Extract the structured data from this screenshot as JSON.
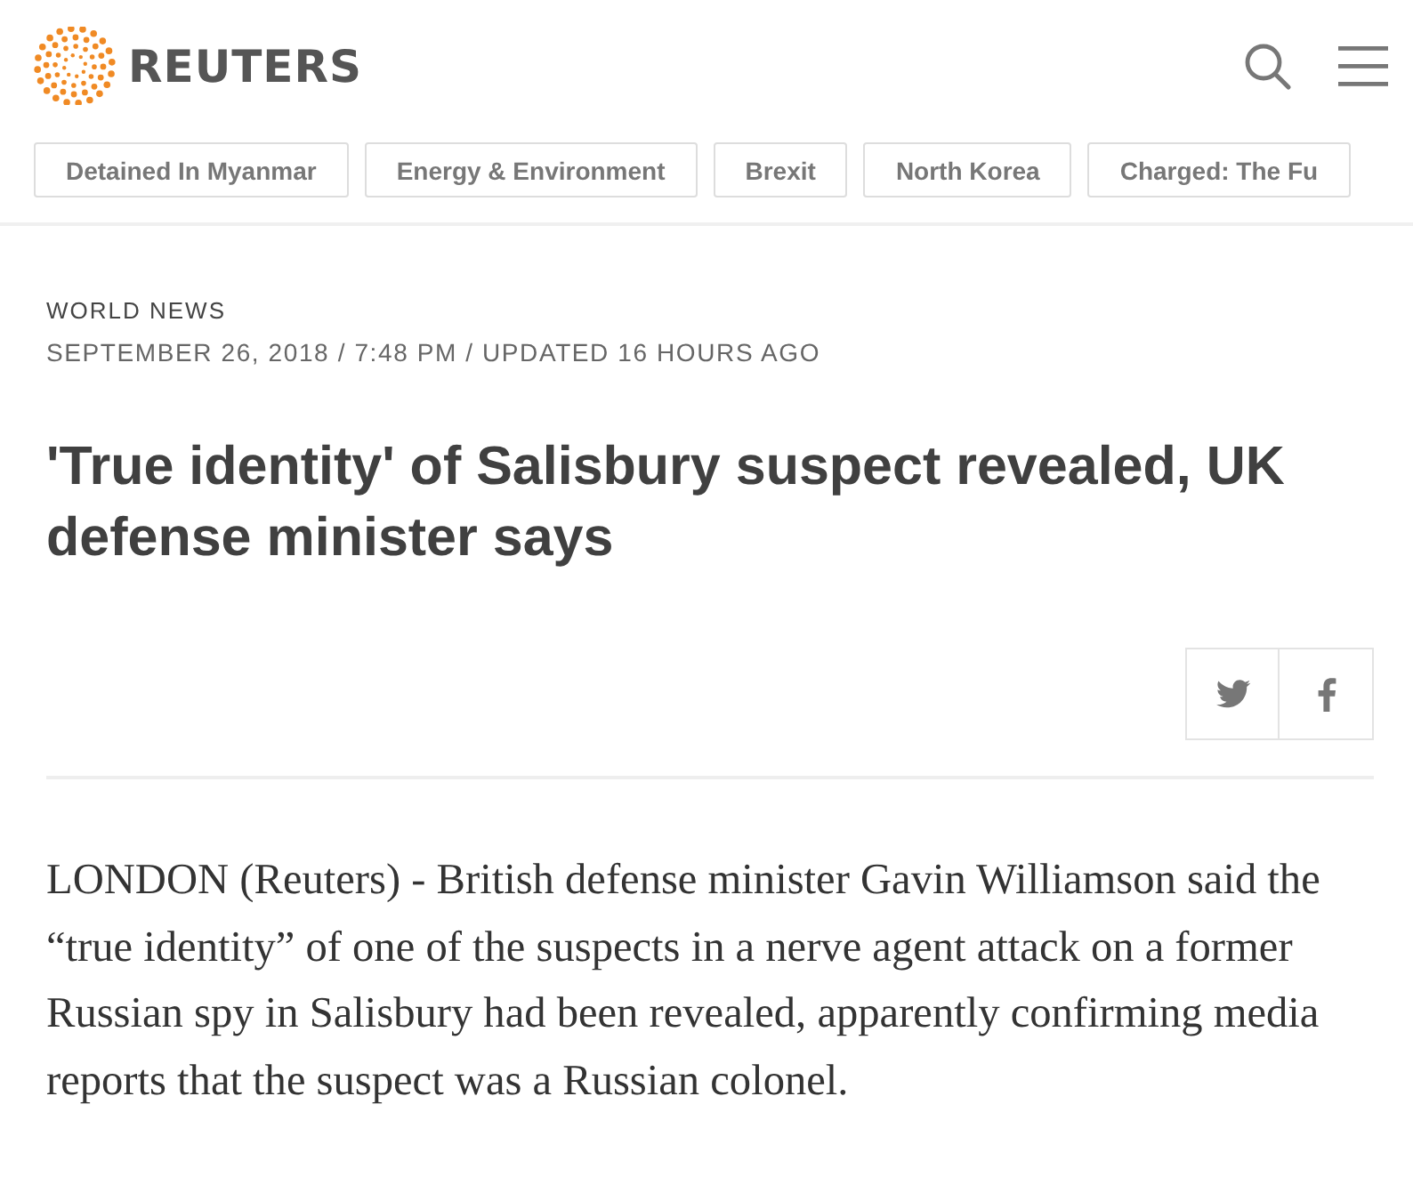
{
  "header": {
    "brand": "REUTERS"
  },
  "topics": [
    "Detained In Myanmar",
    "Energy & Environment",
    "Brexit",
    "North Korea",
    "Charged: The Fu"
  ],
  "article": {
    "section": "WORLD NEWS",
    "dateline": "SEPTEMBER 26, 2018 / 7:48 PM / UPDATED 16 HOURS AGO",
    "headline": "'True identity' of Salisbury suspect revealed, UK defense minister says",
    "share": [
      {
        "kind": "twitter"
      },
      {
        "kind": "facebook"
      }
    ],
    "body": "LONDON (Reuters) - British defense minister Gavin Williamson said the “true identity” of one of the suspects in a nerve agent attack on a former Russian spy in Salisbury had been revealed, apparently confirming media reports that the suspect was a Russian colonel."
  }
}
